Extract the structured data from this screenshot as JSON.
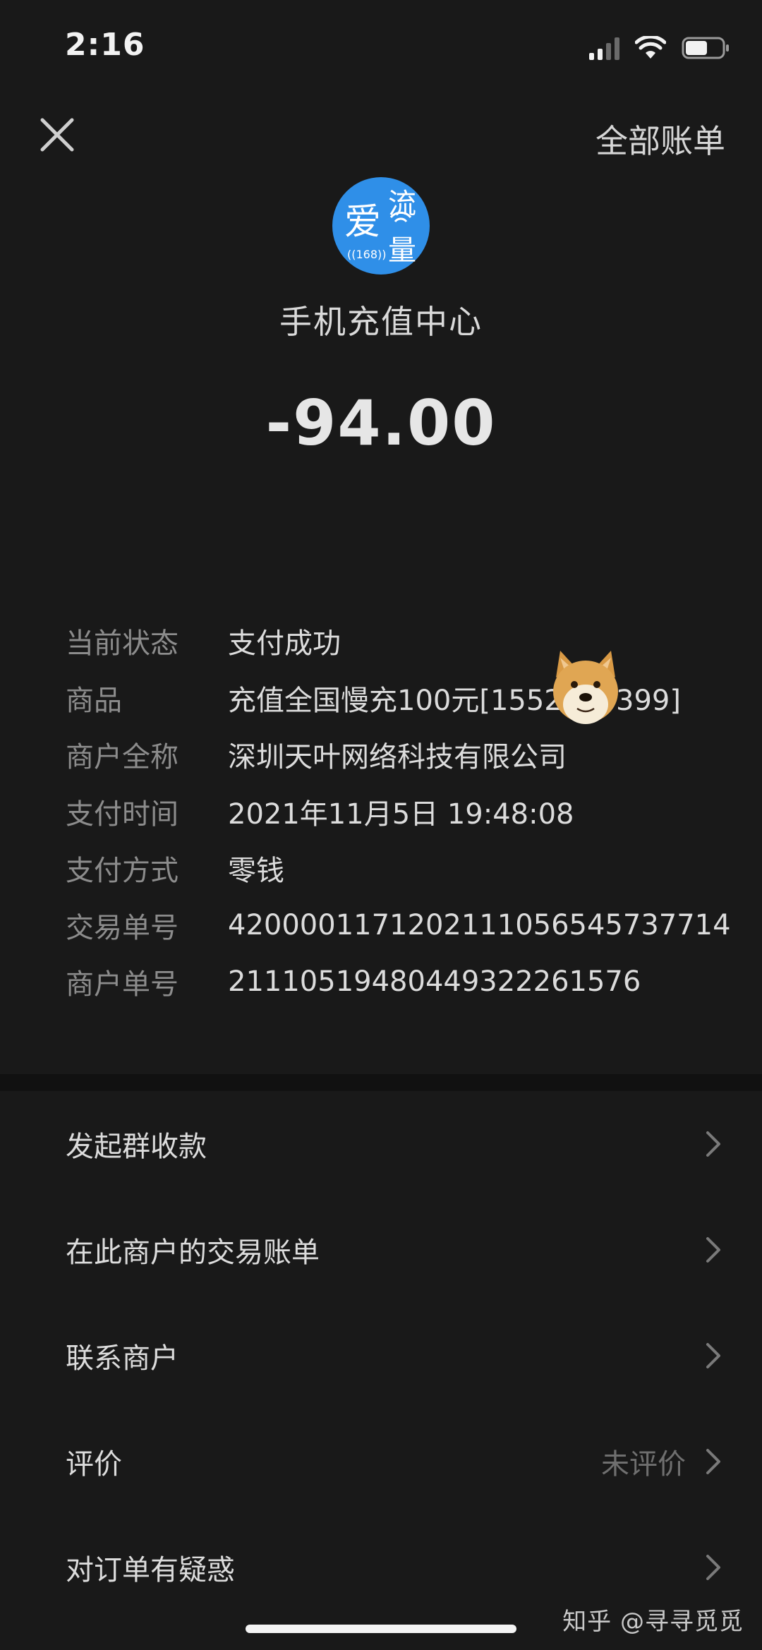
{
  "status_bar": {
    "time": "2:16",
    "battery_level": 0.6
  },
  "header": {
    "close_icon": "close-icon",
    "all_bills_label": "全部账单"
  },
  "merchant": {
    "logo_text_main": "爱",
    "logo_text_side_1": "流",
    "logo_text_side_2": "量",
    "logo_text_badge": "((168))",
    "name": "手机充值中心"
  },
  "amount": "-94.00",
  "details": [
    {
      "label": "当前状态",
      "value": "支付成功"
    },
    {
      "label": "商品",
      "value": "充值全国慢充100元[1552      399]"
    },
    {
      "label": "商户全称",
      "value": "深圳天叶网络科技有限公司"
    },
    {
      "label": "支付时间",
      "value": "2021年11月5日 19:48:08"
    },
    {
      "label": "支付方式",
      "value": "零钱"
    },
    {
      "label": "交易单号",
      "value": "4200001171202111056545737714"
    },
    {
      "label": "商户单号",
      "value": "21110519480449322261576"
    }
  ],
  "actions": [
    {
      "label": "发起群收款",
      "status": ""
    },
    {
      "label": "在此商户的交易账单",
      "status": ""
    },
    {
      "label": "联系商户",
      "status": ""
    },
    {
      "label": "评价",
      "status": "未评价"
    },
    {
      "label": "对订单有疑惑",
      "status": ""
    }
  ],
  "watermark": "知乎 @寻寻觅觅",
  "colors": {
    "background": "#191919",
    "logo_blue": "#2f8fe8",
    "label_gray": "#8c8c8c"
  }
}
